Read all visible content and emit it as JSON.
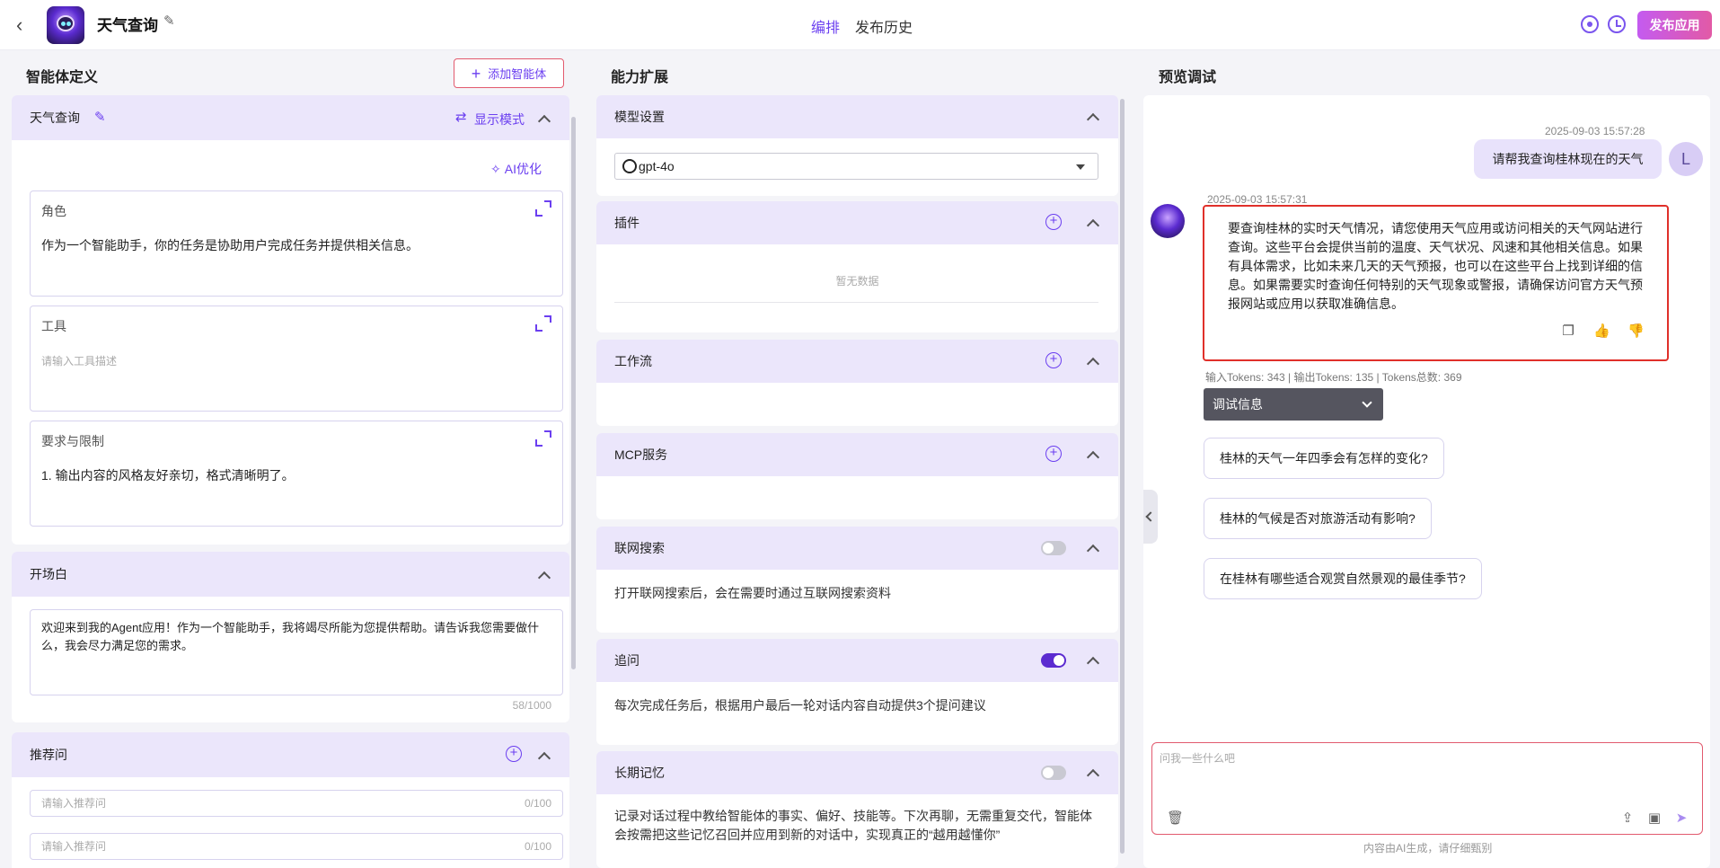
{
  "header": {
    "app_title": "天气查询",
    "tab_edit": "编排",
    "tab_history": "发布历史",
    "publish": "发布应用"
  },
  "left": {
    "section_title": "智能体定义",
    "add_agent": "添加智能体",
    "agent_name": "天气查询",
    "display_mode": "显示模式",
    "ai_optimize": "AI优化",
    "role_label": "角色",
    "role_text": "作为一个智能助手，你的任务是协助用户完成任务并提供相关信息。",
    "tools_label": "工具",
    "tools_placeholder": "请输入工具描述",
    "rules_label": "要求与限制",
    "rules_text": "1. 输出内容的风格友好亲切，格式清晰明了。",
    "opening_label": "开场白",
    "opening_text": "欢迎来到我的Agent应用！作为一个智能助手，我将竭尽所能为您提供帮助。请告诉我您需要做什么，我会尽力满足您的需求。",
    "opening_counter": "58/1000",
    "recommend_label": "推荐问",
    "recommend_placeholder": "请输入推荐问",
    "recommend_counter": "0/100"
  },
  "middle": {
    "section_title": "能力扩展",
    "model_label": "模型设置",
    "model_value": "gpt-4o",
    "plugins_label": "插件",
    "no_data": "暂无数据",
    "workflow_label": "工作流",
    "mcp_label": "MCP服务",
    "web_search_label": "联网搜索",
    "web_search_desc": "打开联网搜索后，会在需要时通过互联网搜索资料",
    "web_search_on": false,
    "followup_label": "追问",
    "followup_desc": "每次完成任务后，根据用户最后一轮对话内容自动提供3个提问建议",
    "followup_on": true,
    "memory_label": "长期记忆",
    "memory_desc_1": "记录对话过程中教给智能体的事实、偏好、技能等。下次再聊，无需重复交代，智能体",
    "memory_desc_2": "会按需把这些记忆召回并应用到新的对话中，实现真正的“越用越懂你”",
    "memory_on": false
  },
  "right": {
    "section_title": "预览调试",
    "user_time": "2025-09-03 15:57:28",
    "user_message": "请帮我查询桂林现在的天气",
    "user_initial": "L",
    "bot_time": "2025-09-03 15:57:31",
    "bot_message": "要查询桂林的实时天气情况，请您使用天气应用或访问相关的天气网站进行查询。这些平台会提供当前的温度、天气状况、风速和其他相关信息。如果有具体需求，比如未来几天的天气预报，也可以在这些平台上找到详细的信息。如果需要实时查询任何特别的天气现象或警报，请确保访问官方天气预报网站或应用以获取准确信息。",
    "tokens": "输入Tokens: 343 | 输出Tokens: 135 | Tokens总数: 369",
    "debug_label": "调试信息",
    "suggestions": [
      "桂林的天气一年四季会有怎样的变化?",
      "桂林的气候是否对旅游活动有影响?",
      "在桂林有哪些适合观赏自然景观的最佳季节?"
    ],
    "input_placeholder": "问我一些什么吧",
    "footer_note": "内容由AI生成，请仔细甄别"
  }
}
